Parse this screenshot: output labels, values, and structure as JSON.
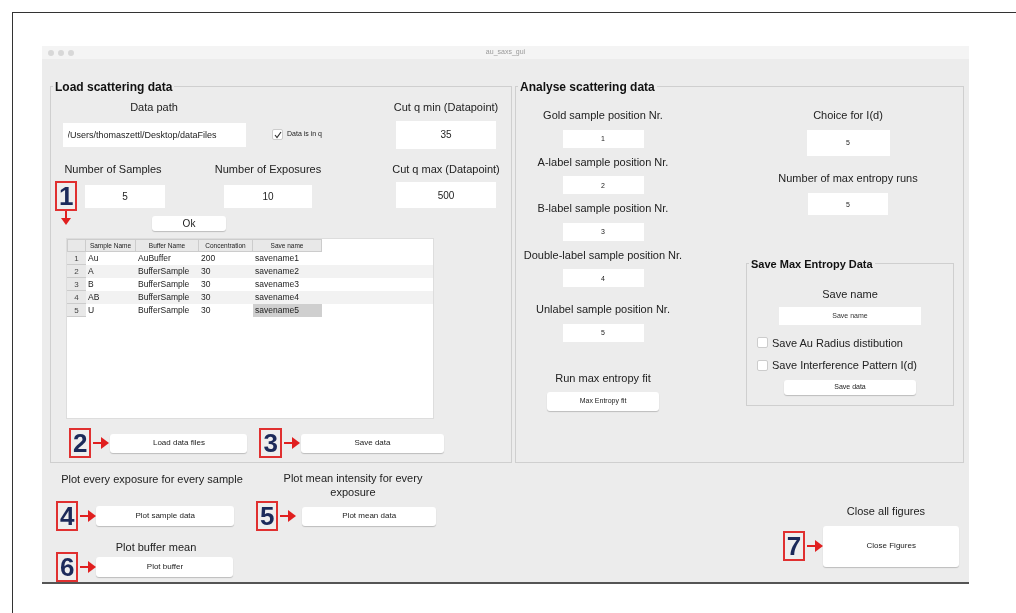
{
  "window": {
    "title": "au_saxs_gui"
  },
  "load_panel": {
    "title": "Load scattering data",
    "data_path": {
      "label": "Data path",
      "value": "/Users/thomaszettl/Desktop/dataFiles"
    },
    "data_in_q": {
      "label": "Data is in q",
      "checked": true
    },
    "cut_q_min": {
      "label": "Cut q min (Datapoint)",
      "value": "35"
    },
    "num_samples": {
      "label": "Number of Samples",
      "value": "5"
    },
    "num_exposures": {
      "label": "Number of Exposures",
      "value": "10"
    },
    "cut_q_max": {
      "label": "Cut q max (Datapoint)",
      "value": "500"
    },
    "ok_button": "Ok",
    "table": {
      "columns": [
        "Sample Name",
        "Buffer Name",
        "Concentration",
        "Save name"
      ],
      "rows": [
        {
          "index": "1",
          "cells": [
            "Au",
            "AuBuffer",
            "200",
            "savename1"
          ],
          "selected": false
        },
        {
          "index": "2",
          "cells": [
            "A",
            "BufferSample",
            "30",
            "savename2"
          ],
          "selected": false
        },
        {
          "index": "3",
          "cells": [
            "B",
            "BufferSample",
            "30",
            "savename3"
          ],
          "selected": false
        },
        {
          "index": "4",
          "cells": [
            "AB",
            "BufferSample",
            "30",
            "savename4"
          ],
          "selected": false
        },
        {
          "index": "5",
          "cells": [
            "U",
            "BufferSample",
            "30",
            "savename5"
          ],
          "selected": true
        }
      ]
    },
    "load_button": "Load data files",
    "save_button": "Save data"
  },
  "plots": {
    "sample_label": "Plot every exposure for every sample",
    "sample_button": "Plot sample data",
    "mean_label": "Plot mean intensity for every exposure",
    "mean_button": "Plot mean data",
    "buffer_label": "Plot buffer mean",
    "buffer_button": "Plot buffer"
  },
  "analyse_panel": {
    "title": "Analyse scattering data",
    "positions": [
      {
        "label": "Gold sample position Nr.",
        "value": "1"
      },
      {
        "label": "A-label sample position Nr.",
        "value": "2"
      },
      {
        "label": "B-label sample position Nr.",
        "value": "3"
      },
      {
        "label": "Double-label sample position Nr.",
        "value": "4"
      },
      {
        "label": "Unlabel sample position Nr.",
        "value": "5"
      }
    ],
    "run_label": "Run max entropy fit",
    "run_button": "Max Entropy fit",
    "choice": {
      "label": "Choice for I(d)",
      "value": "5"
    },
    "runs": {
      "label": "Number of max entropy runs",
      "value": "5"
    },
    "save_panel": {
      "title": "Save Max Entropy Data",
      "name_label": "Save name",
      "name_placeholder": "Save name",
      "options": [
        {
          "label": "Save Au Radius distibution",
          "checked": false
        },
        {
          "label": "Save Interference Pattern I(d)",
          "checked": false
        }
      ],
      "button": "Save data"
    }
  },
  "close": {
    "label": "Close all figures",
    "button": "Close Figures"
  },
  "annotations": [
    {
      "number": "1",
      "kind": "down"
    },
    {
      "number": "2",
      "kind": "right"
    },
    {
      "number": "3",
      "kind": "right"
    },
    {
      "number": "4",
      "kind": "right"
    },
    {
      "number": "5",
      "kind": "right"
    },
    {
      "number": "6",
      "kind": "right"
    },
    {
      "number": "7",
      "kind": "right"
    }
  ]
}
